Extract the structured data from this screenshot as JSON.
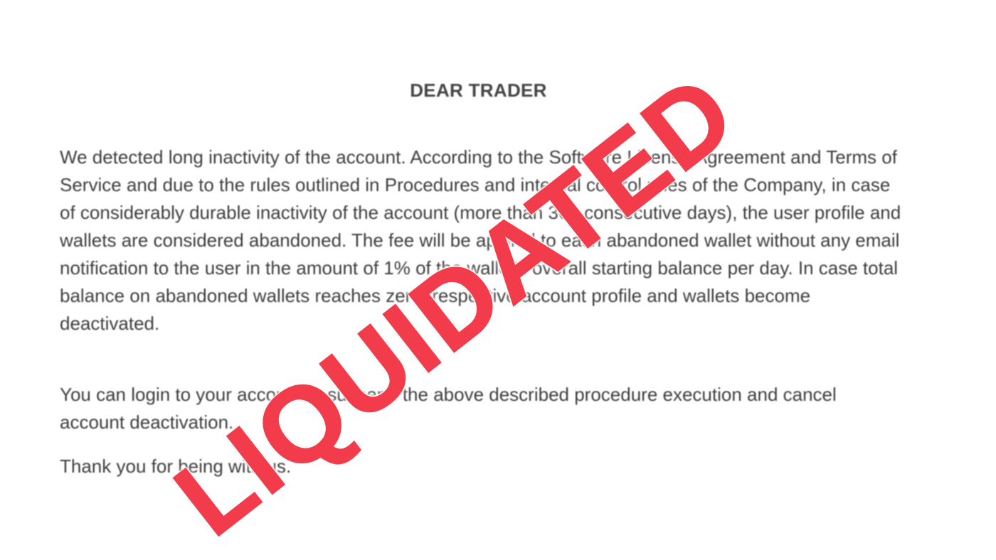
{
  "letter": {
    "title": "DEAR TRADER",
    "paragraph1": "We detected long inactivity of the account. According to the Software License Agreement and Terms of Service and due to the rules outlined in Procedures and internal control rules of the Company, in case of considerably durable inactivity of the account (more than 360 consecutive days), the user profile and wallets are considered abandoned. The fee will be applied to each abandoned wallet without any email notification to the user in the amount of 1% of the wallet's overall starting balance per day. In case total balance on abandoned wallets reaches zero, respective account profile and wallets become deactivated.",
    "paragraph2": "You can login to your account to suspend the above described procedure execution and cancel account deactivation.",
    "paragraph3": "Thank you for being with us."
  },
  "stamp": {
    "text": "LIQUIDATED",
    "color": "#f23c4b"
  }
}
